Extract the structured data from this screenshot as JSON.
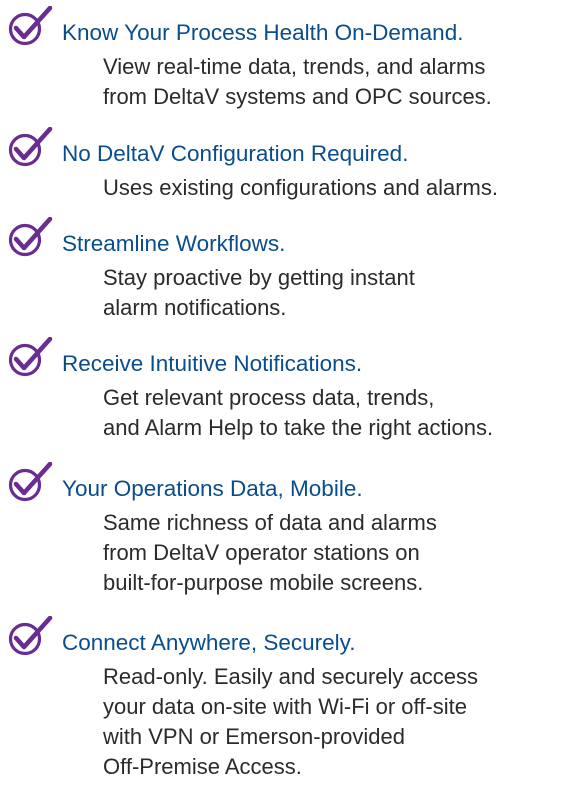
{
  "colors": {
    "title": "#0a4d8c",
    "check": "#6a2c91",
    "body_text": "#2b2b2b",
    "background": "#ffffff"
  },
  "icon": "checkmark-circle-icon",
  "features": [
    {
      "title": "Know Your Process Health On-Demand.",
      "lines": [
        "View real-time data, trends, and alarms",
        "from DeltaV systems and OPC sources."
      ]
    },
    {
      "title": "No DeltaV Configuration Required.",
      "lines": [
        "Uses existing configurations and alarms."
      ]
    },
    {
      "title": "Streamline Workflows.",
      "lines": [
        "Stay proactive by getting instant",
        "alarm notifications."
      ]
    },
    {
      "title": "Receive Intuitive Notifications.",
      "lines": [
        "Get relevant process data, trends,",
        "and Alarm Help to take the right actions."
      ]
    },
    {
      "title": "Your Operations Data, Mobile.",
      "lines": [
        "Same richness of data and alarms",
        "from DeltaV operator stations on",
        "built-for-purpose mobile screens."
      ]
    },
    {
      "title": "Connect Anywhere, Securely.",
      "lines": [
        "Read-only. Easily and securely access",
        "your data on-site with Wi-Fi or off-site",
        "with VPN or Emerson-provided",
        "Off-Premise Access."
      ]
    }
  ]
}
